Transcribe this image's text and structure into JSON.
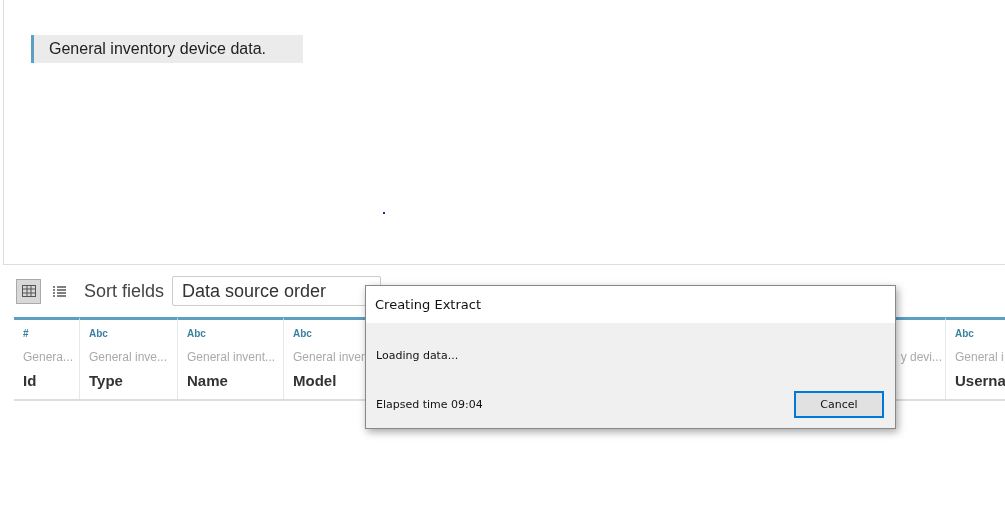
{
  "description": "General inventory device data.",
  "toolbar": {
    "view_buttons": [
      {
        "kind": "grid",
        "selected": true
      },
      {
        "kind": "list",
        "selected": false
      }
    ],
    "sort_label": "Sort fields",
    "sort_value": "Data source order"
  },
  "columns": [
    {
      "type_icon": "#",
      "description": "Genera...",
      "name": "Id"
    },
    {
      "type_icon": "Abc",
      "description": "General inve...",
      "name": "Type"
    },
    {
      "type_icon": "Abc",
      "description": "General invent...",
      "name": "Name"
    },
    {
      "type_icon": "Abc",
      "description": "General inven",
      "name": "Model"
    },
    {
      "description": "y devi..."
    },
    {
      "type_icon": "Abc",
      "description": "General i",
      "name": "Userna"
    }
  ],
  "dialog": {
    "title": "Creating Extract",
    "message": "Loading data...",
    "elapsed": "Elapsed time 09:04",
    "buttons": [
      {
        "label": "Cancel",
        "default": true
      }
    ]
  }
}
